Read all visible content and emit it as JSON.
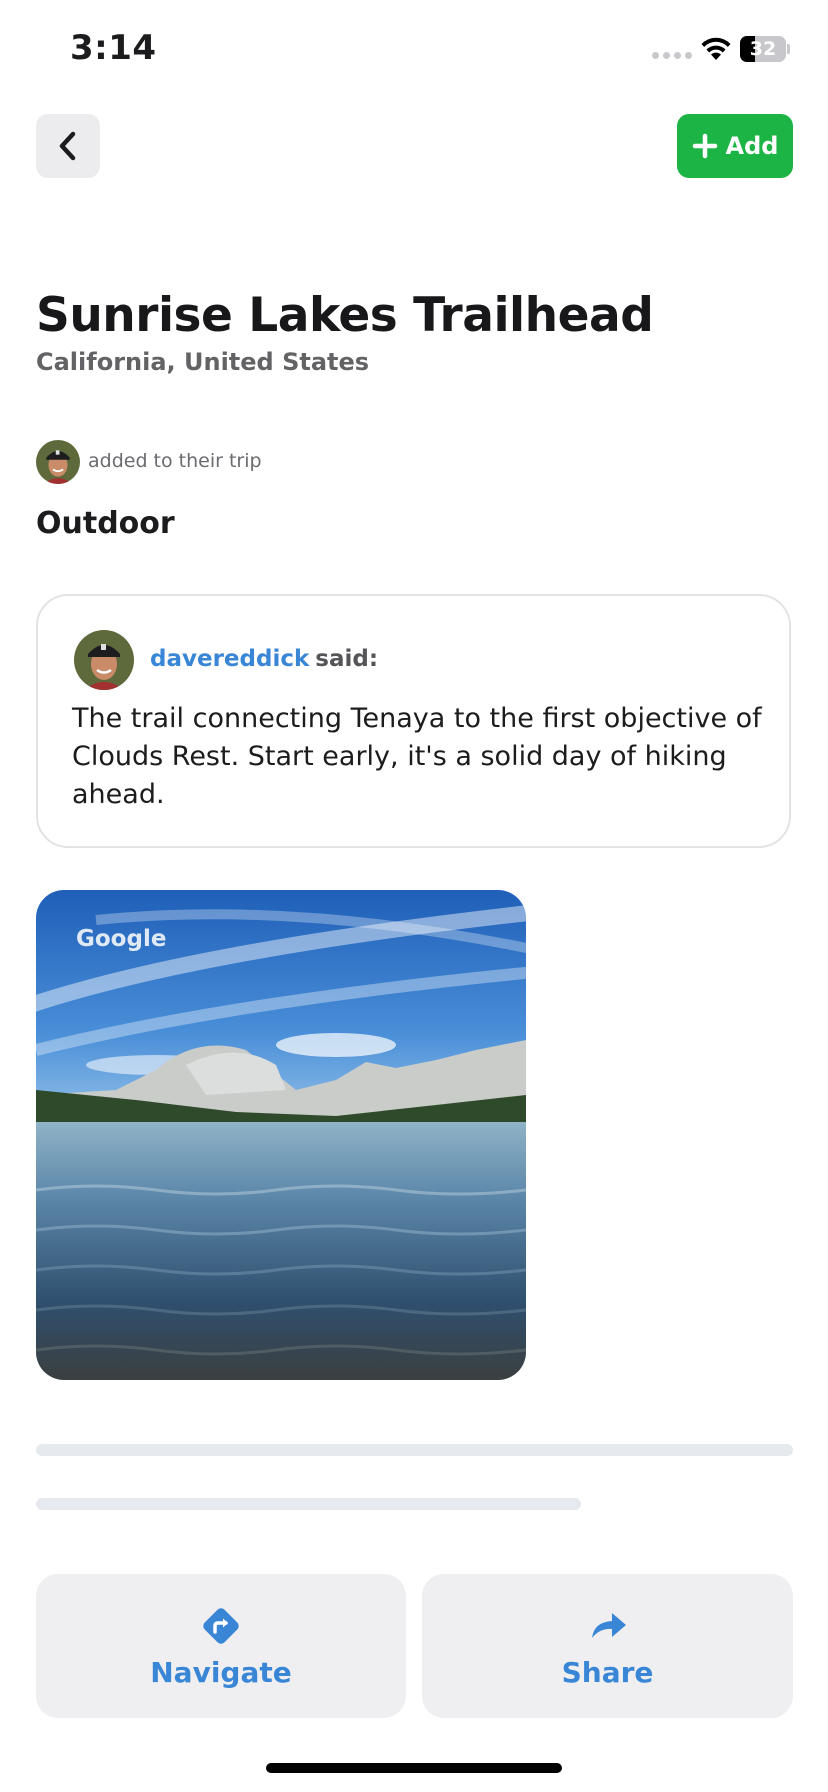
{
  "status_bar": {
    "time": "3:14",
    "battery_level": "32",
    "battery_fraction": 0.32
  },
  "header": {
    "add_label": "Add"
  },
  "place": {
    "title": "Sunrise Lakes Trailhead",
    "subtitle": "California, United States"
  },
  "activity": {
    "added_text": "added to their trip",
    "category": "Outdoor"
  },
  "comment": {
    "username": "davereddick",
    "said": "said:",
    "text": "The trail connecting Tenaya to the first objective of Clouds Rest. Start early, it's a solid day of hiking ahead."
  },
  "photo": {
    "credit": "Google"
  },
  "actions": {
    "navigate_label": "Navigate",
    "share_label": "Share"
  },
  "colors": {
    "accent_blue": "#3a86d6",
    "add_green": "#1db446",
    "button_bg": "#efeff1"
  },
  "icons": [
    "back-chevron-icon",
    "plus-icon",
    "navigate-icon",
    "share-icon",
    "wifi-icon"
  ]
}
